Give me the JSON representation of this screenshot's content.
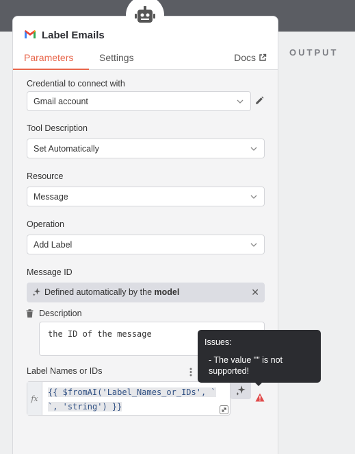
{
  "output_label": "OUTPUT",
  "node": {
    "title": "Label Emails"
  },
  "tabs": {
    "parameters": "Parameters",
    "settings": "Settings",
    "docs": "Docs"
  },
  "fields": {
    "credential": {
      "label": "Credential to connect with",
      "value": "Gmail account"
    },
    "tool_description": {
      "label": "Tool Description",
      "value": "Set Automatically"
    },
    "resource": {
      "label": "Resource",
      "value": "Message"
    },
    "operation": {
      "label": "Operation",
      "value": "Add Label"
    },
    "message_id": {
      "label": "Message ID",
      "prefix": "Defined automatically by the ",
      "bold": "model",
      "close": "✕"
    },
    "description": {
      "label": "Description",
      "value": "the ID of the message"
    },
    "label_names": {
      "label": "Label Names or IDs",
      "fx": "fx",
      "expr_line1": "{{ $fromAI('Label_Names_or_IDs', `",
      "expr_line2": "`, 'string') }}"
    }
  },
  "tooltip": {
    "title": "Issues:",
    "issue": "- The value \"\" is not supported!"
  },
  "colors": {
    "accent": "#e8654a",
    "topbar": "#5b5d63",
    "warning": "#e04a4a"
  }
}
